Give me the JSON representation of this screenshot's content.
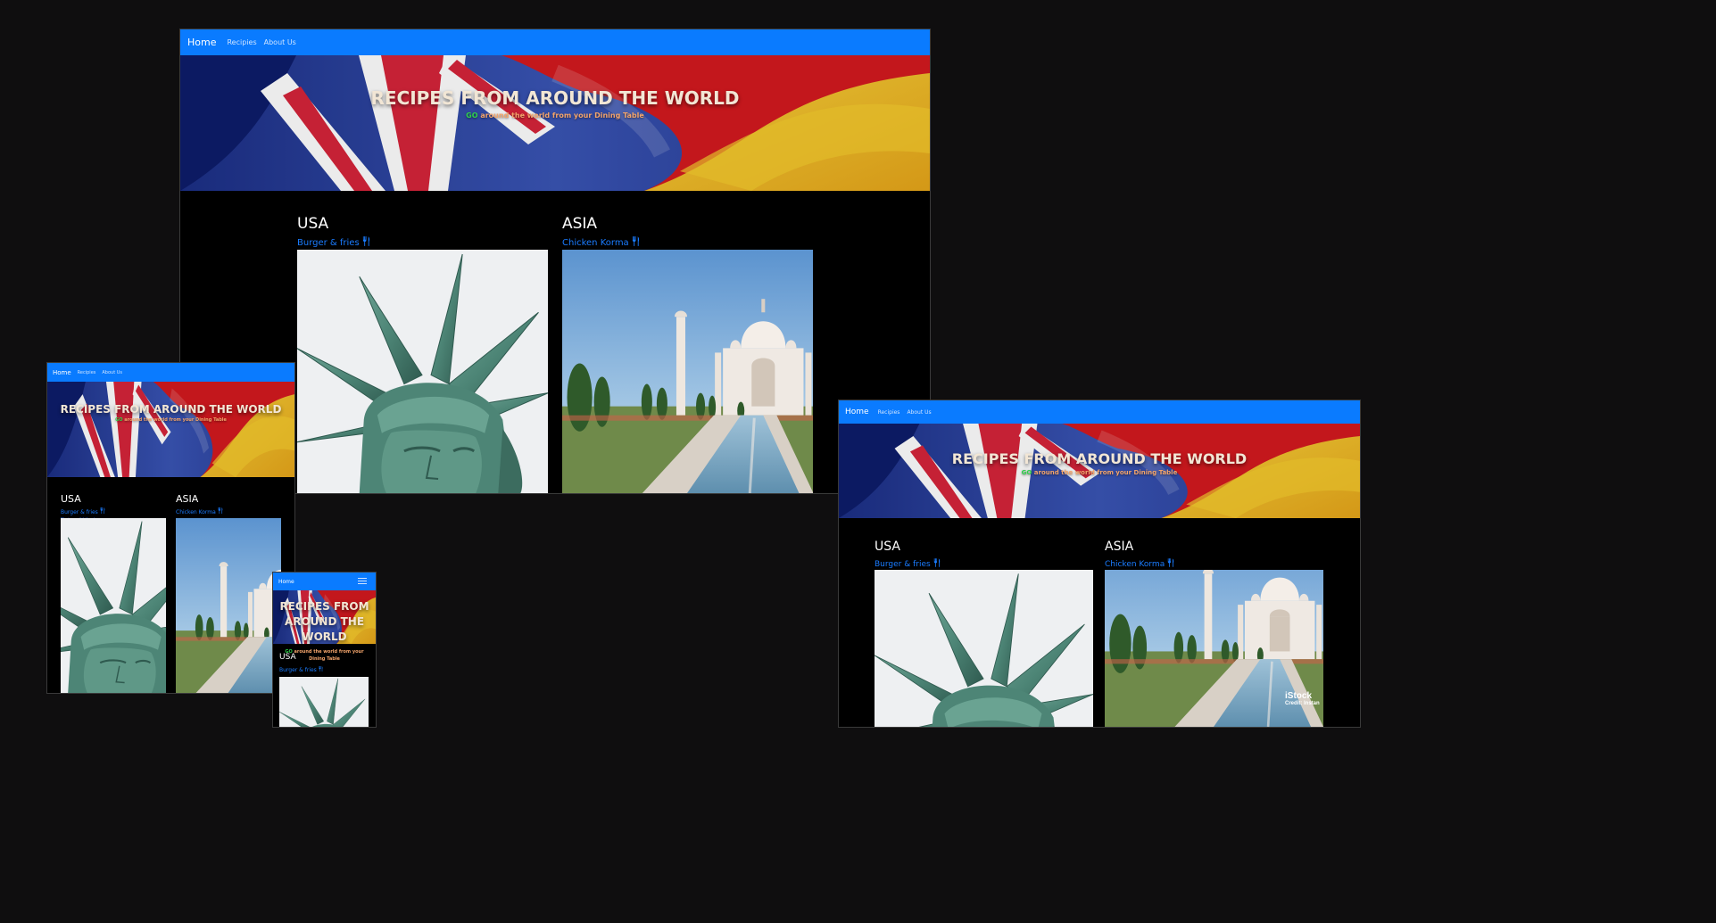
{
  "nav": {
    "home": "Home",
    "recipes": "Recipies",
    "about": "About Us"
  },
  "hero": {
    "title": "RECIPES FROM AROUND THE WORLD",
    "title_mobile_1": "RECIPES FROM",
    "title_mobile_2": "AROUND THE",
    "title_mobile_3": "WORLD",
    "go": "GO",
    "subtitle": " around the world from your Dining Table",
    "subtitle_mobile_1": " around the world from your",
    "subtitle_mobile_2": "Dining Table"
  },
  "regions": {
    "usa": {
      "title": "USA",
      "dish": "Burger & fries",
      "image_alt": "Statue of Liberty"
    },
    "asia": {
      "title": "ASIA",
      "dish": "Chicken Korma"
    }
  },
  "watermark": {
    "brand": "iStock",
    "credit": "Credit: Instan"
  },
  "colors": {
    "nav": "#0a7bff",
    "link": "#1a7cff",
    "page_bg": "#000000",
    "canvas_bg": "#0f0e0f",
    "go_green": "#2fd14a",
    "subtitle_orange": "#f3a46b"
  },
  "icons": {
    "fork_knife": "utensils-icon",
    "menu": "hamburger-icon"
  }
}
